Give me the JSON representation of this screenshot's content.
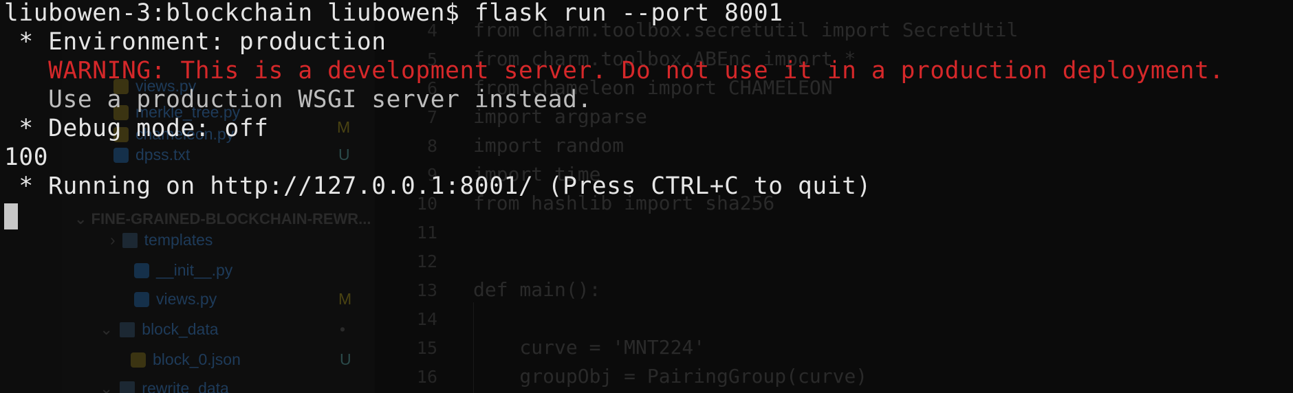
{
  "terminal": {
    "lines": [
      "liubowen-3:blockchain liubowen$ flask run --port 8001",
      " * Environment: production",
      "   WARNING: This is a development server. Do not use it in a production deployment.",
      "   Use a production WSGI server instead.",
      " * Debug mode: off",
      "100",
      " * Running on http://127.0.0.1:8001/ (Press CTRL+C to quit)"
    ],
    "colors": {
      "text": "#e6e6e6",
      "warning": "#d6282a",
      "hint": "#bdbdbd",
      "background": "#0c0c0c"
    }
  },
  "editor_ghost": {
    "explorer": {
      "files_top": [
        {
          "name": "views.py",
          "badge": "M"
        },
        {
          "name": "merkle_tree.py",
          "badge": "M"
        },
        {
          "name": "chameleon.py",
          "badge": "M"
        },
        {
          "name": "dpss.txt",
          "badge": "U"
        }
      ],
      "section_title": "FINE-GRAINED-BLOCKCHAIN-REWR...",
      "items": [
        {
          "name": "templates",
          "badge": ""
        },
        {
          "name": "__init__.py",
          "badge": ""
        },
        {
          "name": "views.py",
          "badge": "M"
        },
        {
          "name": "block_data",
          "badge": "•"
        },
        {
          "name": "block_0.json",
          "badge": "U"
        },
        {
          "name": "rewrite_data",
          "badge": "•"
        }
      ]
    },
    "code": {
      "line_numbers": [
        "4",
        "5",
        "6",
        "7",
        "8",
        "9",
        "10",
        "11",
        "12",
        "13",
        "14",
        "15",
        "16"
      ],
      "lines": [
        "from charm.toolbox.secretutil import SecretUtil",
        "from charm.toolbox.ABEnc import *",
        "from chameleon import CHAMELEON",
        "import argparse",
        "import random",
        "import time",
        "from hashlib import sha256",
        "",
        "",
        "def main():",
        "",
        "    curve = 'MNT224'",
        "    groupObj = PairingGroup(curve)"
      ]
    }
  }
}
